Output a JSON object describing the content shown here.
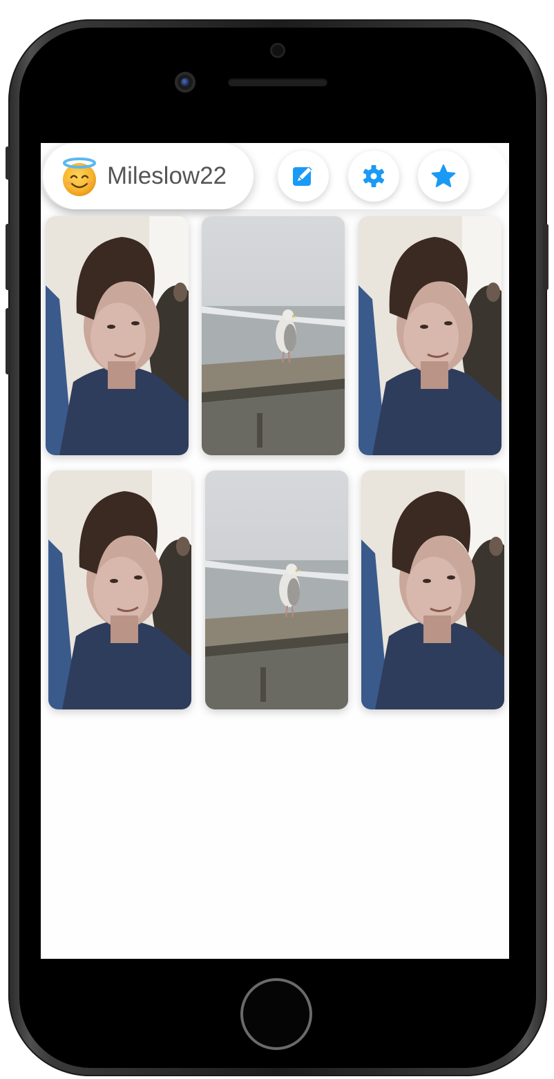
{
  "device": {
    "model": "iphone-frame"
  },
  "header": {
    "avatar_icon": "smiling-face-with-halo-icon",
    "username": "Mileslow22",
    "buttons": [
      {
        "icon": "edit-icon",
        "color": "#1a9af5"
      },
      {
        "icon": "gear-icon",
        "color": "#1a9af5"
      },
      {
        "icon": "star-icon",
        "color": "#1a9af5"
      }
    ]
  },
  "grid": {
    "photos": [
      {
        "subject": "selfie"
      },
      {
        "subject": "seagull"
      },
      {
        "subject": "selfie"
      },
      {
        "subject": "selfie"
      },
      {
        "subject": "seagull"
      },
      {
        "subject": "selfie"
      }
    ]
  },
  "colors": {
    "accent": "#1a9af5",
    "username_text": "#555555",
    "screen_bg": "#fefefe"
  }
}
